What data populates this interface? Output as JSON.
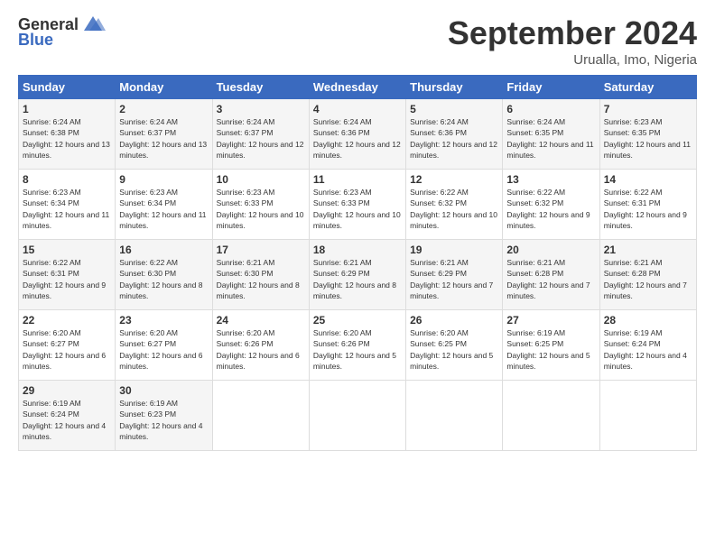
{
  "header": {
    "logo_line1": "General",
    "logo_line2": "Blue",
    "title": "September 2024",
    "subtitle": "Urualla, Imo, Nigeria"
  },
  "days_of_week": [
    "Sunday",
    "Monday",
    "Tuesday",
    "Wednesday",
    "Thursday",
    "Friday",
    "Saturday"
  ],
  "weeks": [
    [
      {
        "day": "1",
        "sunrise": "6:24 AM",
        "sunset": "6:38 PM",
        "daylight": "12 hours and 13 minutes."
      },
      {
        "day": "2",
        "sunrise": "6:24 AM",
        "sunset": "6:37 PM",
        "daylight": "12 hours and 13 minutes."
      },
      {
        "day": "3",
        "sunrise": "6:24 AM",
        "sunset": "6:37 PM",
        "daylight": "12 hours and 12 minutes."
      },
      {
        "day": "4",
        "sunrise": "6:24 AM",
        "sunset": "6:36 PM",
        "daylight": "12 hours and 12 minutes."
      },
      {
        "day": "5",
        "sunrise": "6:24 AM",
        "sunset": "6:36 PM",
        "daylight": "12 hours and 12 minutes."
      },
      {
        "day": "6",
        "sunrise": "6:24 AM",
        "sunset": "6:35 PM",
        "daylight": "12 hours and 11 minutes."
      },
      {
        "day": "7",
        "sunrise": "6:23 AM",
        "sunset": "6:35 PM",
        "daylight": "12 hours and 11 minutes."
      }
    ],
    [
      {
        "day": "8",
        "sunrise": "6:23 AM",
        "sunset": "6:34 PM",
        "daylight": "12 hours and 11 minutes."
      },
      {
        "day": "9",
        "sunrise": "6:23 AM",
        "sunset": "6:34 PM",
        "daylight": "12 hours and 11 minutes."
      },
      {
        "day": "10",
        "sunrise": "6:23 AM",
        "sunset": "6:33 PM",
        "daylight": "12 hours and 10 minutes."
      },
      {
        "day": "11",
        "sunrise": "6:23 AM",
        "sunset": "6:33 PM",
        "daylight": "12 hours and 10 minutes."
      },
      {
        "day": "12",
        "sunrise": "6:22 AM",
        "sunset": "6:32 PM",
        "daylight": "12 hours and 10 minutes."
      },
      {
        "day": "13",
        "sunrise": "6:22 AM",
        "sunset": "6:32 PM",
        "daylight": "12 hours and 9 minutes."
      },
      {
        "day": "14",
        "sunrise": "6:22 AM",
        "sunset": "6:31 PM",
        "daylight": "12 hours and 9 minutes."
      }
    ],
    [
      {
        "day": "15",
        "sunrise": "6:22 AM",
        "sunset": "6:31 PM",
        "daylight": "12 hours and 9 minutes."
      },
      {
        "day": "16",
        "sunrise": "6:22 AM",
        "sunset": "6:30 PM",
        "daylight": "12 hours and 8 minutes."
      },
      {
        "day": "17",
        "sunrise": "6:21 AM",
        "sunset": "6:30 PM",
        "daylight": "12 hours and 8 minutes."
      },
      {
        "day": "18",
        "sunrise": "6:21 AM",
        "sunset": "6:29 PM",
        "daylight": "12 hours and 8 minutes."
      },
      {
        "day": "19",
        "sunrise": "6:21 AM",
        "sunset": "6:29 PM",
        "daylight": "12 hours and 7 minutes."
      },
      {
        "day": "20",
        "sunrise": "6:21 AM",
        "sunset": "6:28 PM",
        "daylight": "12 hours and 7 minutes."
      },
      {
        "day": "21",
        "sunrise": "6:21 AM",
        "sunset": "6:28 PM",
        "daylight": "12 hours and 7 minutes."
      }
    ],
    [
      {
        "day": "22",
        "sunrise": "6:20 AM",
        "sunset": "6:27 PM",
        "daylight": "12 hours and 6 minutes."
      },
      {
        "day": "23",
        "sunrise": "6:20 AM",
        "sunset": "6:27 PM",
        "daylight": "12 hours and 6 minutes."
      },
      {
        "day": "24",
        "sunrise": "6:20 AM",
        "sunset": "6:26 PM",
        "daylight": "12 hours and 6 minutes."
      },
      {
        "day": "25",
        "sunrise": "6:20 AM",
        "sunset": "6:26 PM",
        "daylight": "12 hours and 5 minutes."
      },
      {
        "day": "26",
        "sunrise": "6:20 AM",
        "sunset": "6:25 PM",
        "daylight": "12 hours and 5 minutes."
      },
      {
        "day": "27",
        "sunrise": "6:19 AM",
        "sunset": "6:25 PM",
        "daylight": "12 hours and 5 minutes."
      },
      {
        "day": "28",
        "sunrise": "6:19 AM",
        "sunset": "6:24 PM",
        "daylight": "12 hours and 4 minutes."
      }
    ],
    [
      {
        "day": "29",
        "sunrise": "6:19 AM",
        "sunset": "6:24 PM",
        "daylight": "12 hours and 4 minutes."
      },
      {
        "day": "30",
        "sunrise": "6:19 AM",
        "sunset": "6:23 PM",
        "daylight": "12 hours and 4 minutes."
      },
      null,
      null,
      null,
      null,
      null
    ]
  ]
}
